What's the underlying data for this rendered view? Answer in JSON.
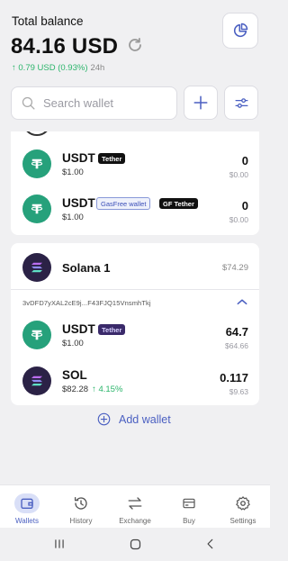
{
  "header": {
    "total_label": "Total balance",
    "total_value": "84.16 USD",
    "change_arrow": "↑",
    "change_value": "0.79 USD (0.93%)",
    "change_period": "24h",
    "icons": {
      "refresh": "refresh-icon",
      "pie": "pie-chart-icon"
    }
  },
  "search": {
    "placeholder": "Search wallet",
    "value": ""
  },
  "toolbar": {
    "add_icon": "plus-icon",
    "filter_icon": "sliders-icon"
  },
  "wallet1": {
    "assets": [
      {
        "symbol": "USDT",
        "tags": [
          "Tether"
        ],
        "price": "$1.00",
        "amount": "0",
        "fiat": "$0.00"
      },
      {
        "symbol": "USDT",
        "tags": [
          "GasFree wallet",
          "GF Tether"
        ],
        "price": "$1.00",
        "amount": "0",
        "fiat": "$0.00"
      }
    ]
  },
  "wallet2": {
    "name": "Solana 1",
    "total": "$74.29",
    "address": "3vDFD7yXAL2cE9j...F43FJQ15VnsmhTkj",
    "assets": [
      {
        "symbol": "USDT",
        "tag": "Tether",
        "price": "$1.00",
        "amount": "64.7",
        "fiat": "$64.66"
      },
      {
        "symbol": "SOL",
        "price": "$82.28",
        "change": "↑ 4.15%",
        "amount": "0.117",
        "fiat": "$9.63"
      }
    ]
  },
  "add_wallet": {
    "label": "Add wallet"
  },
  "tabs": [
    {
      "label": "Wallets",
      "icon": "wallet-icon",
      "active": true
    },
    {
      "label": "History",
      "icon": "history-icon",
      "active": false
    },
    {
      "label": "Exchange",
      "icon": "exchange-icon",
      "active": false
    },
    {
      "label": "Buy",
      "icon": "card-icon",
      "active": false
    },
    {
      "label": "Settings",
      "icon": "gear-icon",
      "active": false
    }
  ],
  "colors": {
    "accent": "#4a5fc1",
    "positive": "#2bb56b",
    "tether": "#26a17b",
    "solana_bg": "#2b2246"
  }
}
